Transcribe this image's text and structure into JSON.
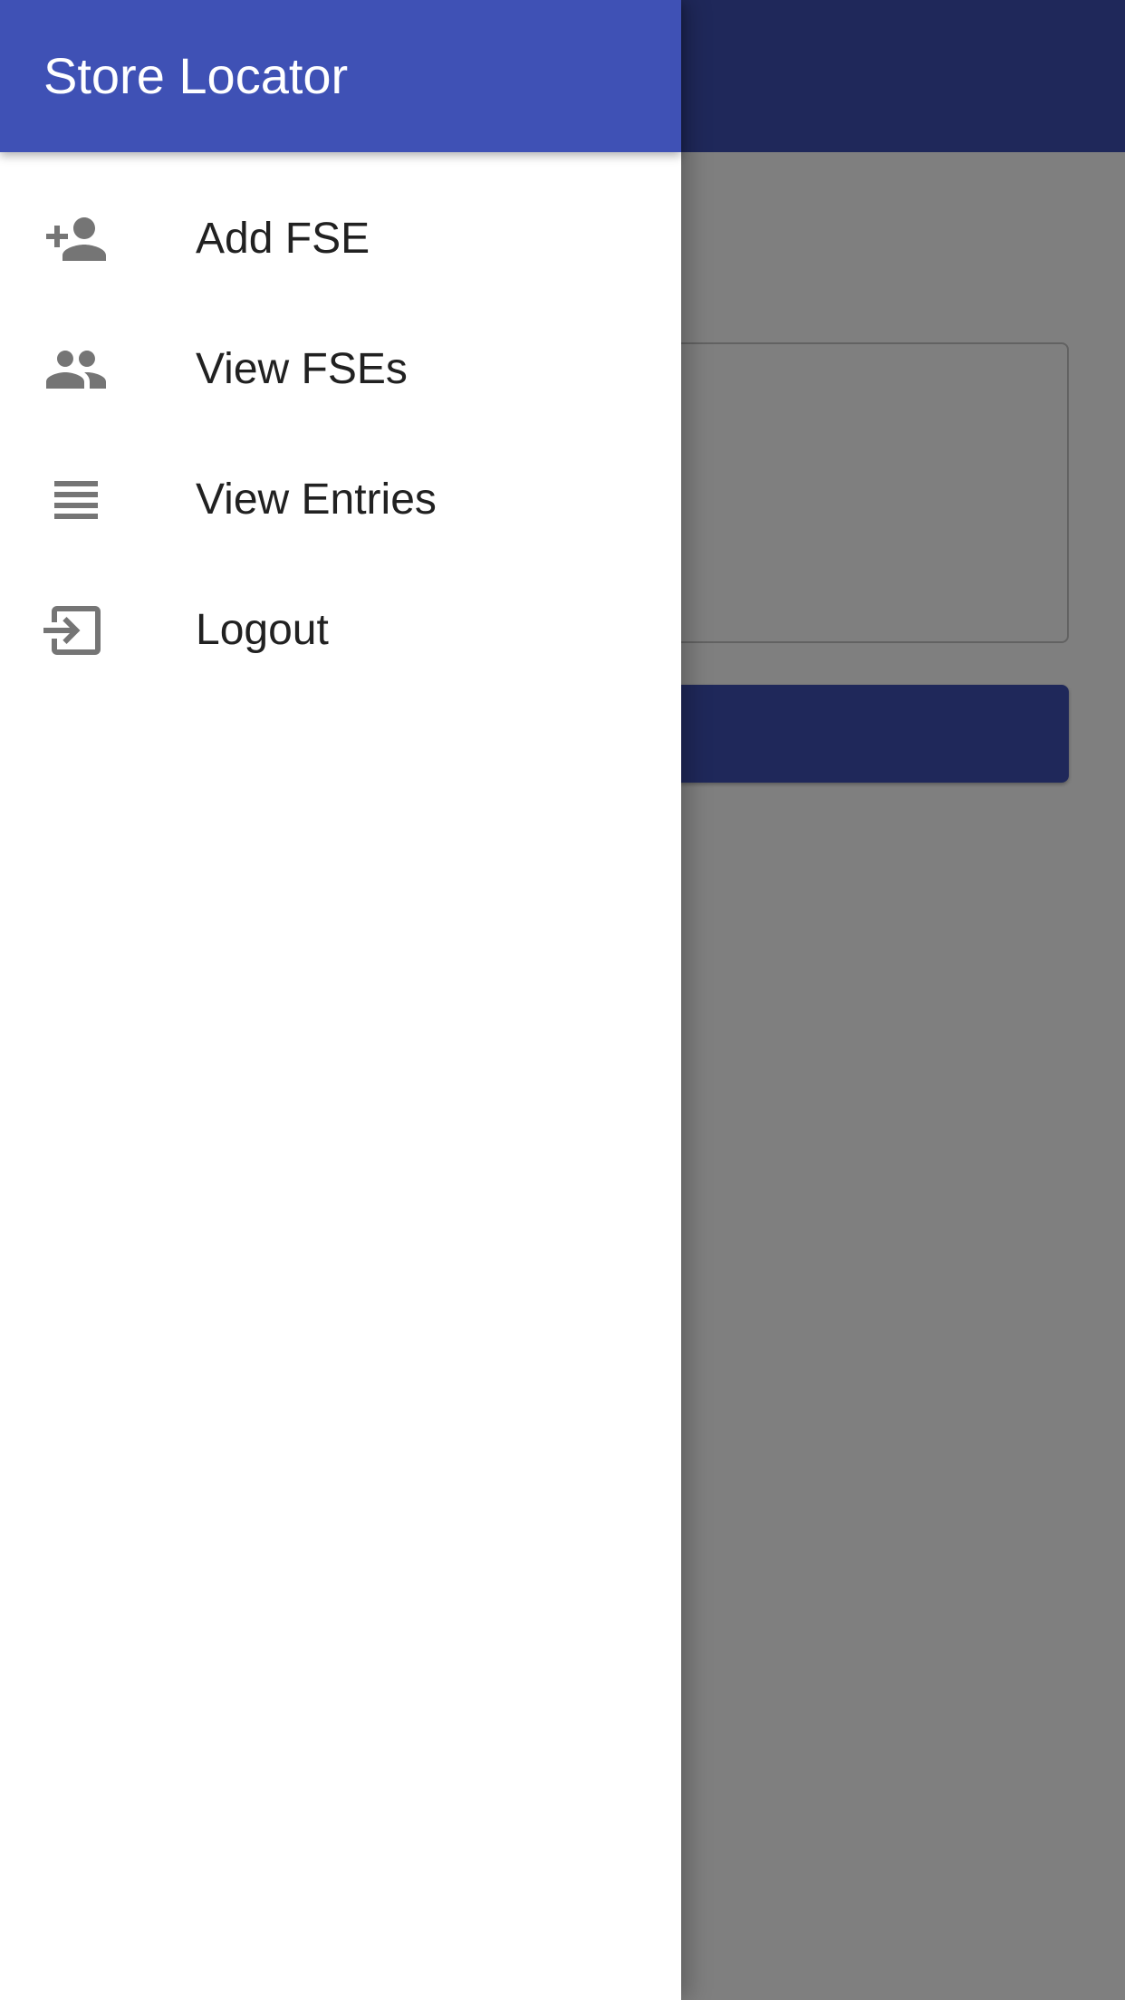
{
  "drawer": {
    "title": "Store Locator",
    "items": [
      {
        "label": "Add FSE",
        "icon": "person-add-icon"
      },
      {
        "label": "View FSEs",
        "icon": "people-icon"
      },
      {
        "label": "View Entries",
        "icon": "list-icon"
      },
      {
        "label": "Logout",
        "icon": "exit-icon"
      }
    ]
  },
  "colors": {
    "primary": "#3f51b5",
    "icon": "#757575",
    "text": "#212121",
    "scrim": "rgba(0,0,0,0.5)"
  }
}
